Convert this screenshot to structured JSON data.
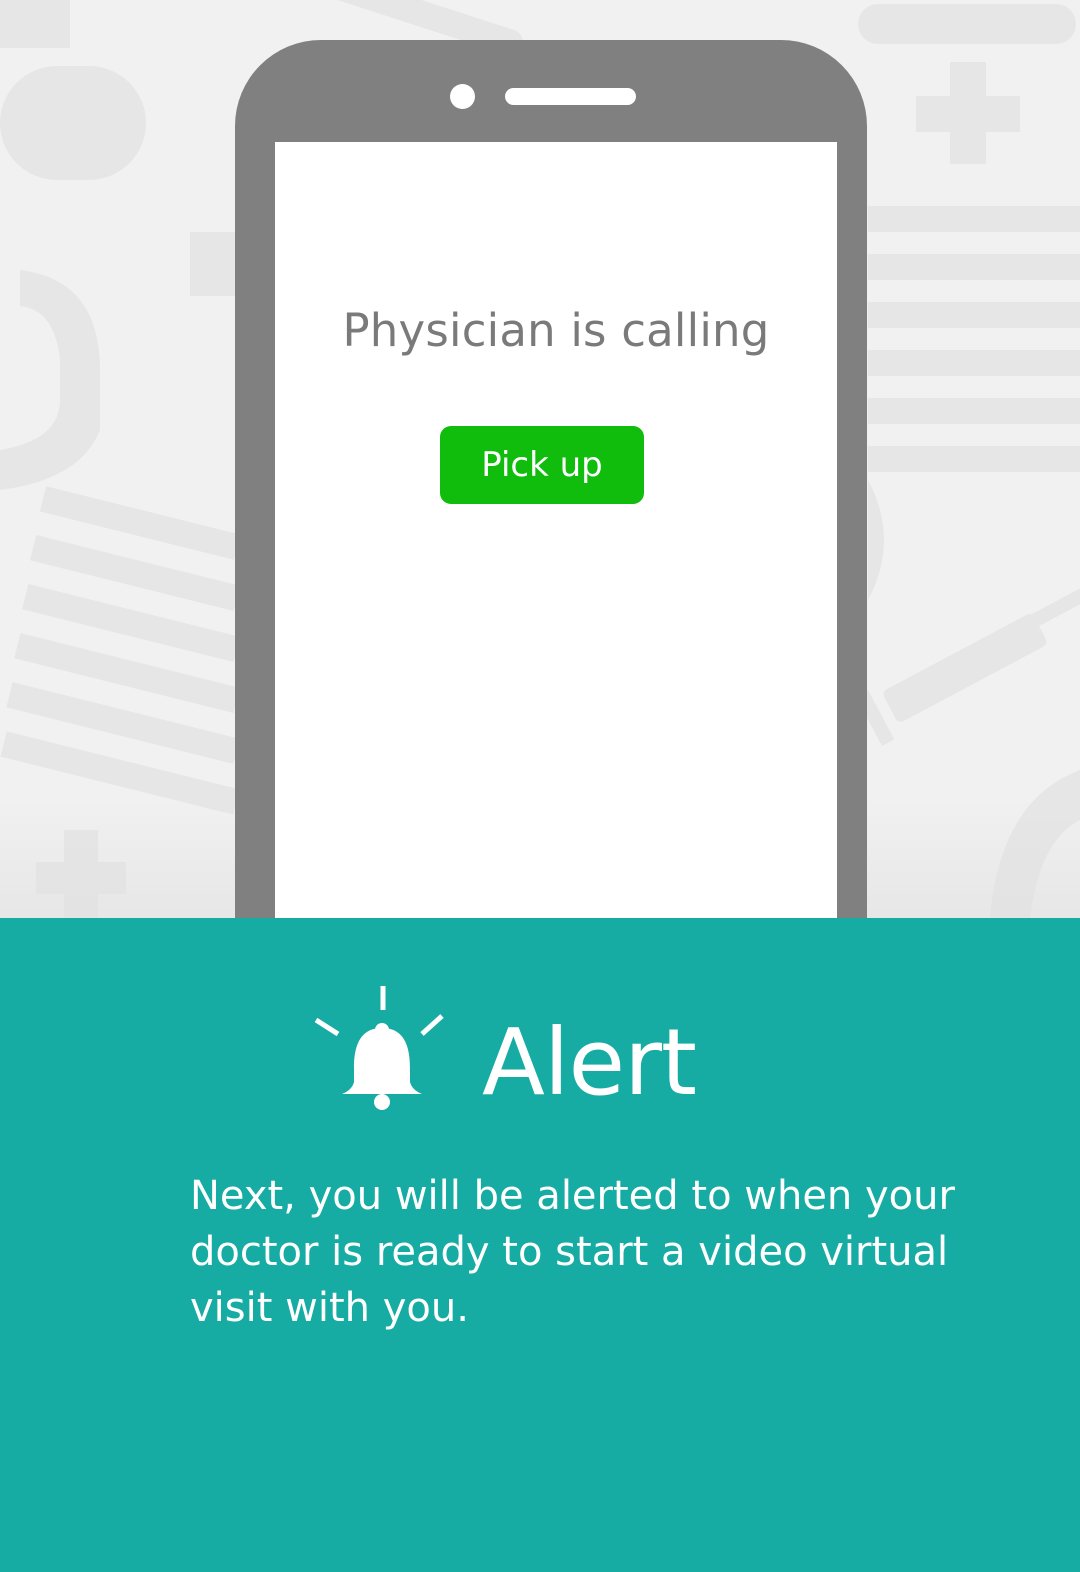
{
  "phone": {
    "call_text": "Physician is calling",
    "pickup_label": "Pick up"
  },
  "alert": {
    "title": "Alert",
    "description": "Next, you will be alerted to when your doctor is ready to start a video virtual visit with you.",
    "icon": "bell-ringing-icon"
  },
  "colors": {
    "background": "#f1f1f1",
    "phone_frame": "#808080",
    "pickup_button": "#10bd0d",
    "panel": "#17aca3",
    "text_gray": "#7a7a7a"
  }
}
